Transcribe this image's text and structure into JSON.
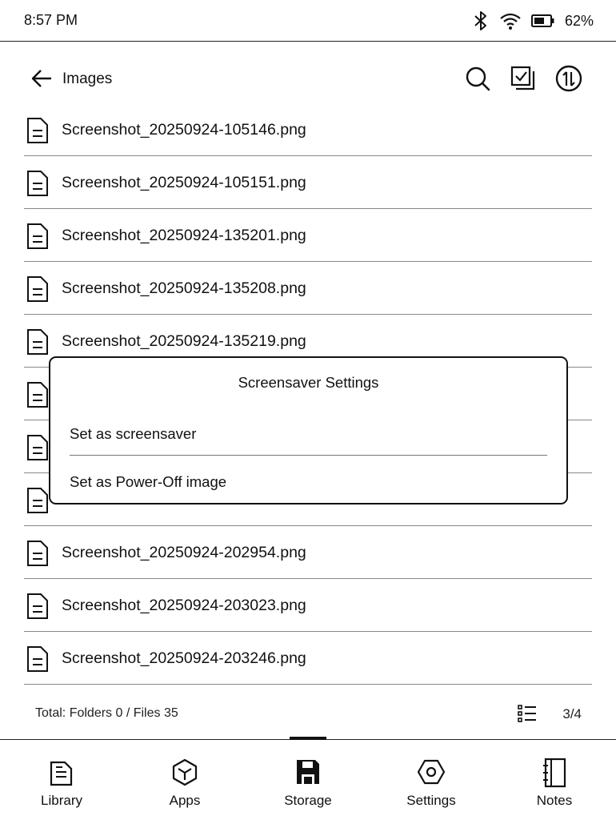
{
  "status": {
    "time": "8:57 PM",
    "battery": "62%"
  },
  "header": {
    "title": "Images"
  },
  "files": [
    "Screenshot_20250924-105146.png",
    "Screenshot_20250924-105151.png",
    "Screenshot_20250924-135201.png",
    "Screenshot_20250924-135208.png",
    "Screenshot_20250924-135219.png",
    "",
    "",
    "",
    "Screenshot_20250924-202954.png",
    "Screenshot_20250924-203023.png",
    "Screenshot_20250924-203246.png"
  ],
  "footer": {
    "summary": "Total: Folders 0 / Files 35",
    "page": "3/4"
  },
  "nav": {
    "library": "Library",
    "apps": "Apps",
    "storage": "Storage",
    "settings": "Settings",
    "notes": "Notes",
    "active": "storage"
  },
  "dialog": {
    "title": "Screensaver Settings",
    "option_screensaver": "Set as screensaver",
    "option_poweroff": "Set as Power-Off image"
  }
}
